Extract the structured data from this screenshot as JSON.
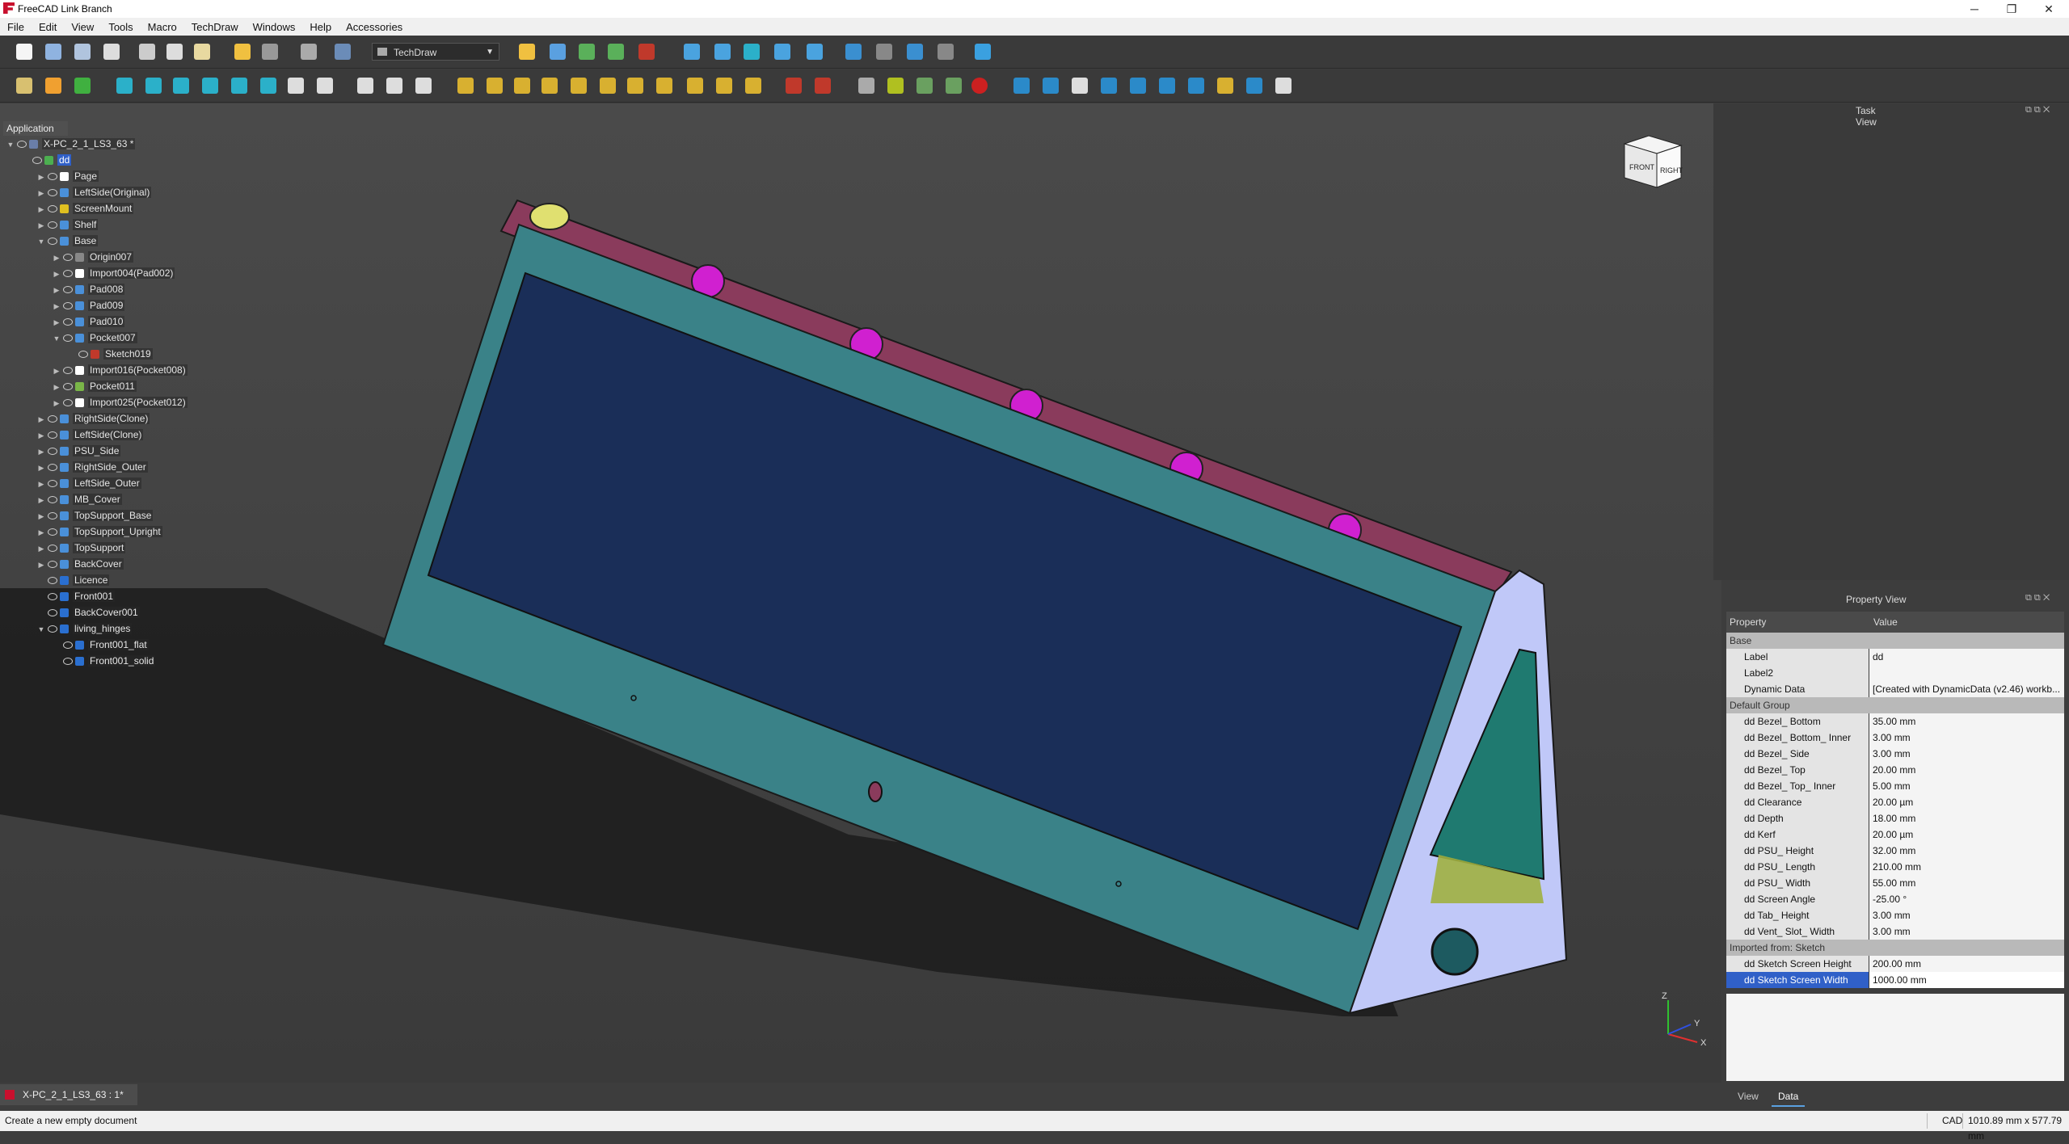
{
  "window": {
    "title": "FreeCAD Link Branch"
  },
  "menu": [
    "File",
    "Edit",
    "View",
    "Tools",
    "Macro",
    "TechDraw",
    "Windows",
    "Help",
    "Accessories"
  ],
  "toolbar": {
    "workbench": "TechDraw"
  },
  "tree": {
    "tab_label": "Application",
    "rows": [
      {
        "label": "X-PC_2_1_LS3_63 *",
        "depth": 0,
        "exp": "open",
        "eye": false,
        "icon": "#6a7ea8"
      },
      {
        "label": "dd",
        "depth": 1,
        "exp": "",
        "eye": true,
        "icon": "#4caf50",
        "selected": true
      },
      {
        "label": "Page",
        "depth": 2,
        "exp": "closed",
        "eye": true,
        "icon": "#ffffff"
      },
      {
        "label": "LeftSide(Original)",
        "depth": 2,
        "exp": "closed",
        "eye": true,
        "icon": "#4a90d9"
      },
      {
        "label": "ScreenMount",
        "depth": 2,
        "exp": "closed",
        "eye": true,
        "icon": "#e0c020"
      },
      {
        "label": "Shelf",
        "depth": 2,
        "exp": "closed",
        "eye": true,
        "icon": "#4a90d9"
      },
      {
        "label": "Base",
        "depth": 2,
        "exp": "open",
        "eye": true,
        "icon": "#4a90d9"
      },
      {
        "label": "Origin007",
        "depth": 3,
        "exp": "closed",
        "eye": true,
        "icon": "#888888"
      },
      {
        "label": "Import004(Pad002)",
        "depth": 3,
        "exp": "closed",
        "eye": true,
        "icon": "#ffffff"
      },
      {
        "label": "Pad008",
        "depth": 3,
        "exp": "closed",
        "eye": true,
        "icon": "#4a90d9"
      },
      {
        "label": "Pad009",
        "depth": 3,
        "exp": "closed",
        "eye": true,
        "icon": "#4a90d9"
      },
      {
        "label": "Pad010",
        "depth": 3,
        "exp": "closed",
        "eye": true,
        "icon": "#4a90d9"
      },
      {
        "label": "Pocket007",
        "depth": 3,
        "exp": "open",
        "eye": true,
        "icon": "#4a90d9"
      },
      {
        "label": "Sketch019",
        "depth": 4,
        "exp": "",
        "eye": true,
        "icon": "#c0392b"
      },
      {
        "label": "Import016(Pocket008)",
        "depth": 3,
        "exp": "closed",
        "eye": true,
        "icon": "#ffffff"
      },
      {
        "label": "Pocket011",
        "depth": 3,
        "exp": "closed",
        "eye": true,
        "icon": "#7ab648"
      },
      {
        "label": "Import025(Pocket012)",
        "depth": 3,
        "exp": "closed",
        "eye": true,
        "icon": "#ffffff"
      },
      {
        "label": "RightSide(Clone)",
        "depth": 2,
        "exp": "closed",
        "eye": true,
        "icon": "#4a90d9"
      },
      {
        "label": "LeftSide(Clone)",
        "depth": 2,
        "exp": "closed",
        "eye": true,
        "icon": "#4a90d9"
      },
      {
        "label": "PSU_Side",
        "depth": 2,
        "exp": "closed",
        "eye": true,
        "icon": "#4a90d9"
      },
      {
        "label": "RightSide_Outer",
        "depth": 2,
        "exp": "closed",
        "eye": true,
        "icon": "#4a90d9"
      },
      {
        "label": "LeftSide_Outer",
        "depth": 2,
        "exp": "closed",
        "eye": true,
        "icon": "#4a90d9"
      },
      {
        "label": "MB_Cover",
        "depth": 2,
        "exp": "closed",
        "eye": true,
        "icon": "#4a90d9"
      },
      {
        "label": "TopSupport_Base",
        "depth": 2,
        "exp": "closed",
        "eye": true,
        "icon": "#4a90d9"
      },
      {
        "label": "TopSupport_Upright",
        "depth": 2,
        "exp": "closed",
        "eye": true,
        "icon": "#4a90d9"
      },
      {
        "label": "TopSupport",
        "depth": 2,
        "exp": "closed",
        "eye": true,
        "icon": "#4a90d9"
      },
      {
        "label": "BackCover",
        "depth": 2,
        "exp": "closed",
        "eye": true,
        "icon": "#4a90d9"
      },
      {
        "label": "Licence",
        "depth": 2,
        "exp": "",
        "eye": true,
        "icon": "#2a6fd0"
      },
      {
        "label": "Front001",
        "depth": 2,
        "exp": "",
        "eye": true,
        "icon": "#2a6fd0"
      },
      {
        "label": "BackCover001",
        "depth": 2,
        "exp": "",
        "eye": true,
        "icon": "#2a6fd0"
      },
      {
        "label": "living_hinges",
        "depth": 2,
        "exp": "open",
        "eye": true,
        "icon": "#2a6fd0"
      },
      {
        "label": "Front001_flat",
        "depth": 3,
        "exp": "",
        "eye": true,
        "icon": "#2a6fd0"
      },
      {
        "label": "Front001_solid",
        "depth": 3,
        "exp": "",
        "eye": true,
        "icon": "#2a6fd0"
      }
    ]
  },
  "navcube": {
    "front": "FRONT",
    "right": "RIGHT"
  },
  "task_view": {
    "title": "Task View"
  },
  "property_view": {
    "title": "Property View",
    "header": {
      "property": "Property",
      "value": "Value"
    },
    "rows": [
      {
        "group": "Base"
      },
      {
        "k": "Label",
        "v": "dd"
      },
      {
        "k": "Label2",
        "v": ""
      },
      {
        "k": "Dynamic Data",
        "v": "[Created with DynamicData (v2.46) workb..."
      },
      {
        "group": "Default Group"
      },
      {
        "k": "dd Bezel_ Bottom",
        "v": "35.00 mm"
      },
      {
        "k": "dd Bezel_ Bottom_ Inner",
        "v": "3.00 mm"
      },
      {
        "k": "dd Bezel_ Side",
        "v": "3.00 mm"
      },
      {
        "k": "dd Bezel_ Top",
        "v": "20.00 mm"
      },
      {
        "k": "dd Bezel_ Top_ Inner",
        "v": "5.00 mm"
      },
      {
        "k": "dd Clearance",
        "v": "20.00 µm"
      },
      {
        "k": "dd Depth",
        "v": "18.00 mm"
      },
      {
        "k": "dd Kerf",
        "v": "20.00 µm"
      },
      {
        "k": "dd PSU_ Height",
        "v": "32.00 mm"
      },
      {
        "k": "dd PSU_ Length",
        "v": "210.00 mm"
      },
      {
        "k": "dd PSU_ Width",
        "v": "55.00 mm"
      },
      {
        "k": "dd Screen Angle",
        "v": "-25.00 °"
      },
      {
        "k": "dd Tab_ Height",
        "v": "3.00 mm"
      },
      {
        "k": "dd Vent_ Slot_ Width",
        "v": "3.00 mm"
      },
      {
        "group": "Imported from: Sketch"
      },
      {
        "k": "dd Sketch Screen Height",
        "v": "200.00 mm"
      },
      {
        "k": "dd Sketch Screen Width",
        "v": "1000.00 mm",
        "selected": true
      }
    ],
    "tabs": [
      "View",
      "Data"
    ]
  },
  "document_tab": {
    "label": "X-PC_2_1_LS3_63 : 1*"
  },
  "axis": {
    "x": "X",
    "y": "Y",
    "z": "Z"
  },
  "status": {
    "message": "Create a new empty document",
    "nav": "CAD",
    "dims": "1010.89 mm x 577.79 mm"
  }
}
